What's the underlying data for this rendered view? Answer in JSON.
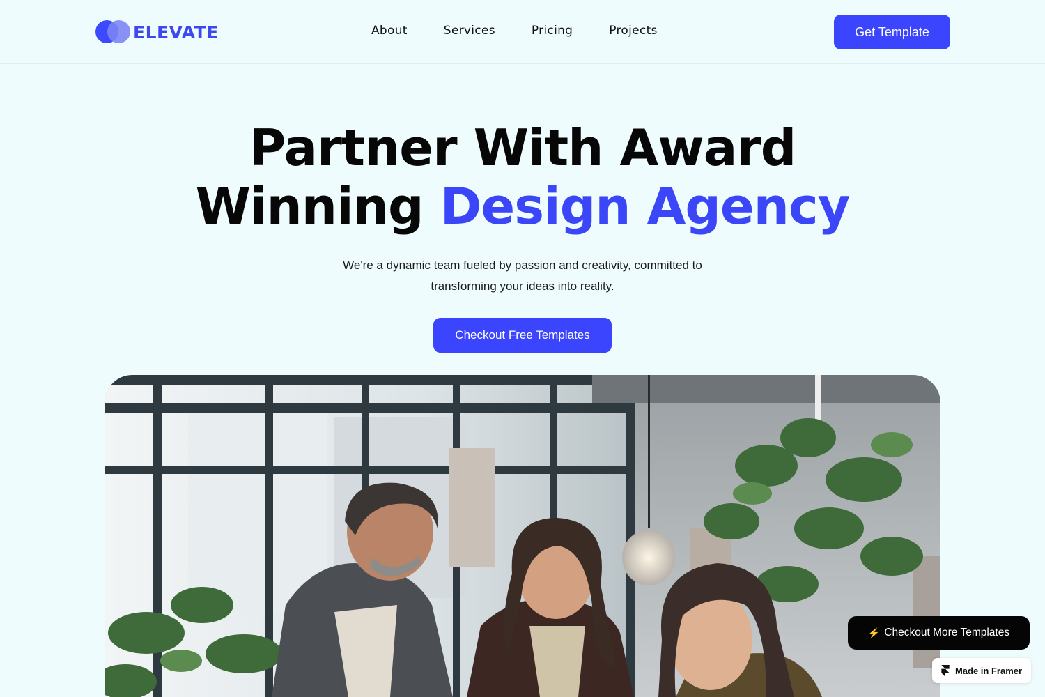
{
  "header": {
    "brand": "ELEVATE",
    "nav": [
      {
        "label": "About"
      },
      {
        "label": "Services"
      },
      {
        "label": "Pricing"
      },
      {
        "label": "Projects"
      }
    ],
    "cta_label": "Get Template"
  },
  "hero": {
    "title_line1": "Partner With Award",
    "title_line2_plain": "Winning ",
    "title_line2_accent": "Design Agency",
    "subtitle": "We're a dynamic team fueled by passion and creativity, committed to transforming your ideas into reality.",
    "cta_label": "Checkout Free Templates",
    "photo_icon": "team-meeting-photo"
  },
  "floating": {
    "more_templates_label": "Checkout More Templates",
    "bolt_icon": "lightning-icon",
    "made_in_label": "Made in Framer",
    "framer_icon": "framer-icon"
  },
  "colors": {
    "background": "#effcfd",
    "accent": "#3b45fd",
    "text": "#070707",
    "badge_dark": "#050505"
  }
}
